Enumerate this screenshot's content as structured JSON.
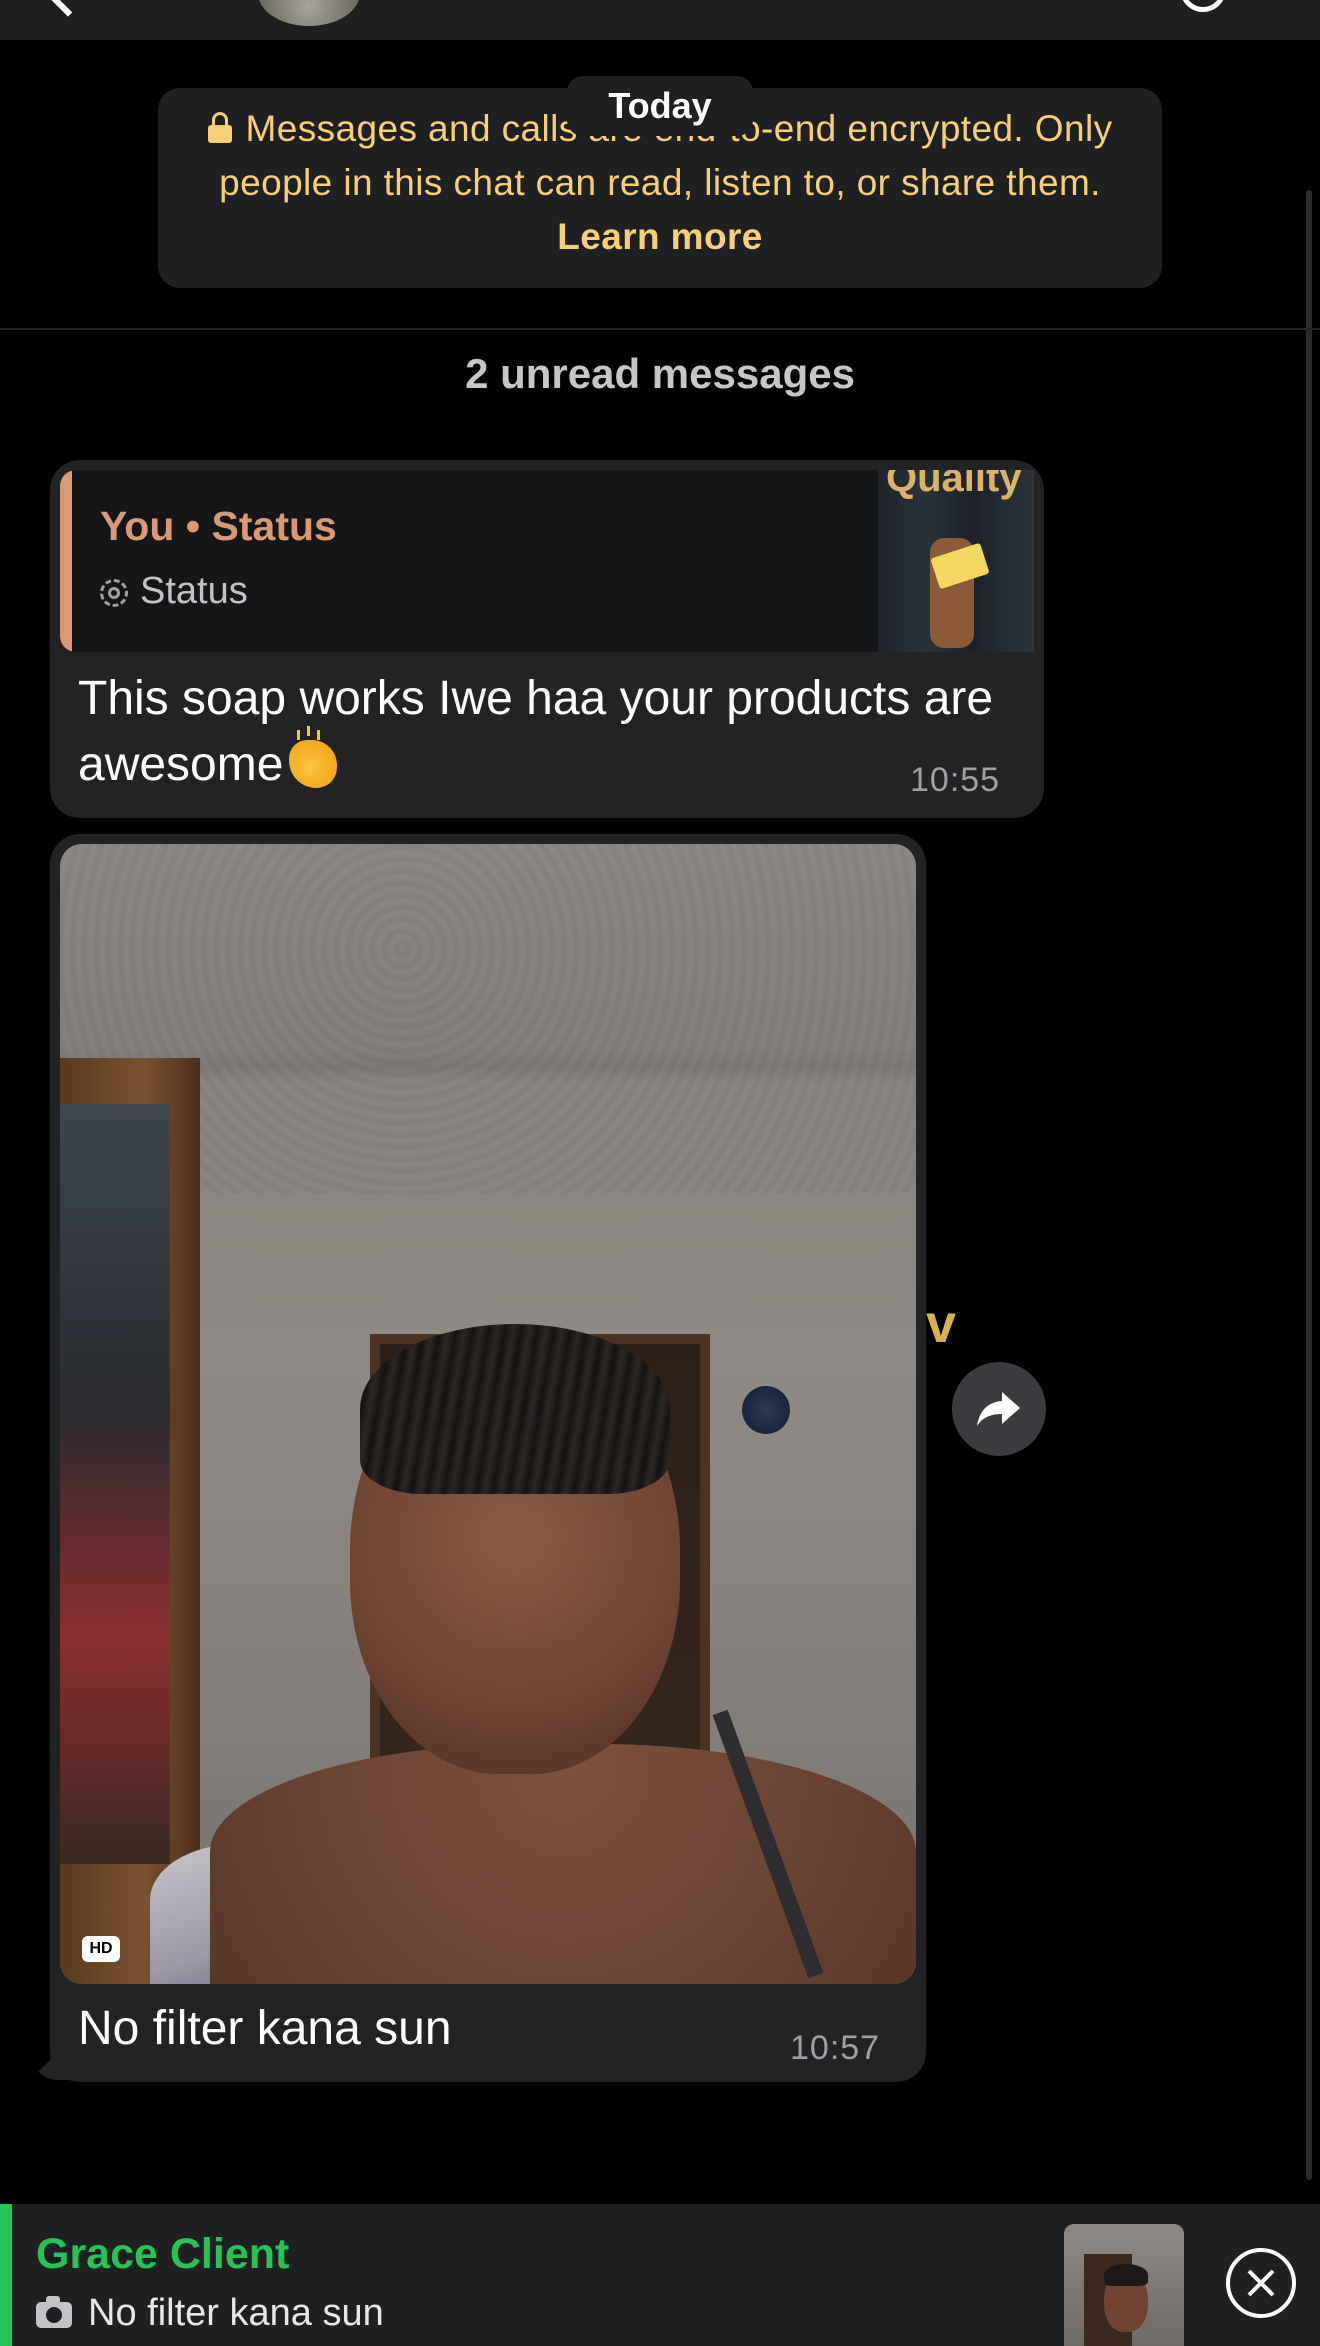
{
  "encryption_notice": {
    "date_chip": "Today",
    "line_main": "Messages and calls are end-to-end encrypted. Only people in this chat can read, listen to, or share them.",
    "link": "Learn more"
  },
  "unread_divider": "2 unread messages",
  "messages": [
    {
      "quoted": {
        "title": "You • Status",
        "subtitle": "Status"
      },
      "text": "This soap works Iwe haa your products are awesome",
      "emoji_icon": "clapping-hands-icon",
      "time": "10:55"
    },
    {
      "media": {
        "badge": "HD"
      },
      "text": "No filter kana sun",
      "time": "10:57"
    }
  ],
  "reply_bar": {
    "contact_name": "Grace Client",
    "preview_text": "No filter kana sun",
    "icon": "camera-icon"
  },
  "colors": {
    "background": "#000000",
    "bubble": "#222325",
    "notice_text": "#f6cf77",
    "quote_accent": "#d89a74",
    "reply_accent": "#26c25a"
  }
}
